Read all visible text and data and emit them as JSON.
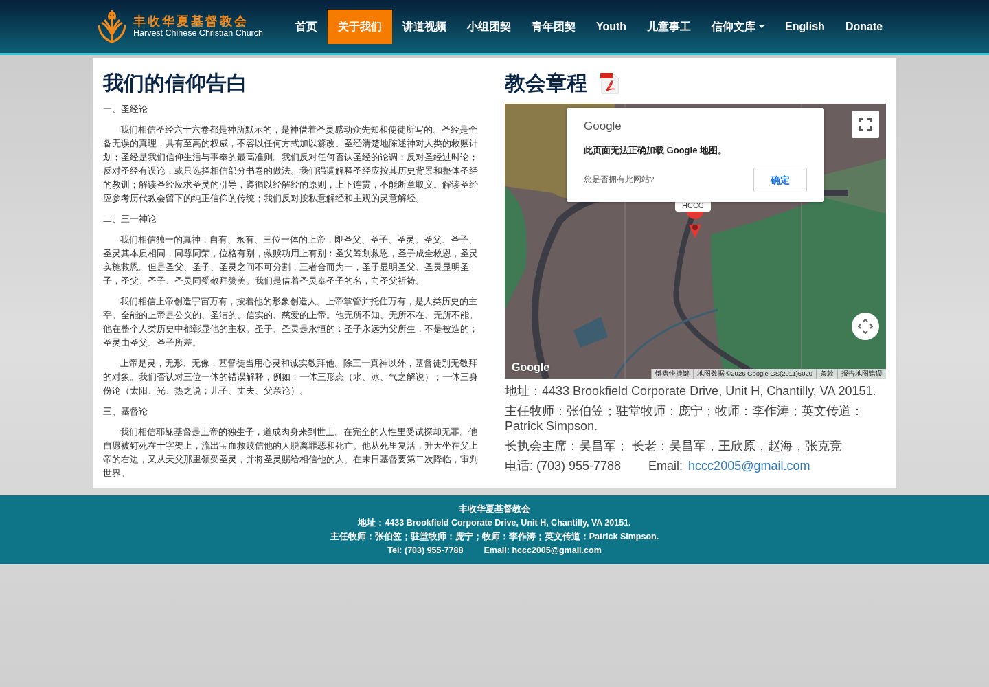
{
  "header": {
    "logo": {
      "name_zh": "丰收华夏基督教会",
      "name_en": "Harvest Chinese Christian Church"
    },
    "nav": [
      {
        "label": "首页",
        "selected": false,
        "dropdown": false
      },
      {
        "label": "关于我们",
        "selected": true,
        "dropdown": false
      },
      {
        "label": "讲道视频",
        "selected": false,
        "dropdown": false
      },
      {
        "label": "小组团契",
        "selected": false,
        "dropdown": false
      },
      {
        "label": "青年团契",
        "selected": false,
        "dropdown": false
      },
      {
        "label": "Youth",
        "selected": false,
        "dropdown": false
      },
      {
        "label": "儿童事工",
        "selected": false,
        "dropdown": false
      },
      {
        "label": "信仰文库",
        "selected": false,
        "dropdown": true
      },
      {
        "label": "English",
        "selected": false,
        "dropdown": false
      },
      {
        "label": "Donate",
        "selected": false,
        "dropdown": false
      }
    ]
  },
  "faith": {
    "title": "我们的信仰告白",
    "sections": [
      {
        "heading": "一、圣经论",
        "paragraphs": [
          "我们相信圣经六十六卷都是神所默示的，是神借着圣灵感动众先知和使徒所写的。圣经是全备无误的真理，具有至高的权威，不容以任何方式加以篡改。圣经清楚地陈述神对人类的救赎计划；圣经是我们信仰生活与事奉的最高准则。我们反对任何否认圣经的论调；反对圣经过时论；反对圣经有误论，或只选择相信部分书卷的做法。我们强调解释圣经应按其历史背景和整体圣经的教训；解读圣经应求圣灵的引导，遵循以经解经的原则，上下连贯，不能断章取义。解读圣经应参考历代教会留下的纯正信仰的传统；我们反对按私意解经和主观的灵意解经。"
        ]
      },
      {
        "heading": "二、三一神论",
        "paragraphs": [
          "我们相信独一的真神，自有、永有、三位一体的上帝，即圣父、圣子、圣灵。圣父、圣子、圣灵其本质相同，同尊同荣，位格有别，救赎功用上有别：圣父筹划救恩，圣子成全救恩，圣灵实施救恩。但是圣父、圣子、圣灵之间不可分割，三者合而为一，圣子显明圣父、圣灵显明圣子，圣父、圣子、圣灵同受敬拜赞美。我们是借着圣灵奉圣子的名，向圣父祈祷。",
          "我们相信上帝创造宇宙万有，按着他的形象创造人。上帝掌管并托住万有，是人类历史的主宰。全能的上帝是公义的、圣洁的、信实的、慈爱的上帝。他无所不知、无所不在、无所不能。他在整个人类历史中都彰显他的主权。圣子、圣灵是永恒的：圣子永远为父所生，不是被造的；圣灵由圣父、圣子所差。",
          "上帝是灵，无形、无像，基督徒当用心灵和诚实敬拜他。除三一真神以外，基督徒别无敬拜的对象。我们否认对三位一体的错误解释，例如：一体三形态（水、冰、气之解说）；一体三身份论（太阳、光、热之说；儿子、丈夫、父亲论）。"
        ]
      },
      {
        "heading": "三、基督论",
        "paragraphs": [
          "我们相信耶稣基督是上帝的独生子，道成肉身来到世上。在完全的人性里受试探却无罪。他自愿被钉死在十字架上，流出宝血救赎信他的人脱离罪恶和死亡。他从死里复活，升天坐在父上帝的右边，又从天父那里领受圣灵，并将圣灵赐给相信他的人。在末日基督要第二次降临，审判世界。"
        ]
      }
    ]
  },
  "bylaws": {
    "title": "教会章程",
    "map": {
      "kind": "picture",
      "marker_label": "HCCC",
      "dialog": {
        "brand": "Google",
        "message": "此页面无法正确加载 Google 地图。",
        "question": "您是否拥有此网站?",
        "button": "确定"
      },
      "watermark": "Google",
      "attribution": [
        "键盘快捷键",
        "地图数据 ©2026 Google GS(2011)6020",
        "条款",
        "报告地图错误"
      ]
    },
    "contact": {
      "address": "地址：4433 Brookfield Corporate Drive, Unit H, Chantilly, VA 20151.",
      "pastors": "主任牧师：张伯笠；驻堂牧师：庞宁；牧师：李作涛；英文传道：Patrick Simpson.",
      "elders": "长执会主席：吴昌军； 长老：吴昌军，王欣原，赵海，张克竞",
      "phone": "电话: (703) 955-7788",
      "email_label": "Email:",
      "email": "hccc2005@gmail.com"
    }
  },
  "footer": {
    "name": "丰收华夏基督教会",
    "address": "地址：4433 Brookfield Corporate Drive, Unit H, Chantilly, VA 20151.",
    "pastors": "主任牧师：张伯笠；驻堂牧师：庞宁；牧师：李作涛；英文传道：Patrick Simpson.",
    "tel": "Tel: (703) 955-7788",
    "email": "Email: hccc2005@gmail.com"
  }
}
